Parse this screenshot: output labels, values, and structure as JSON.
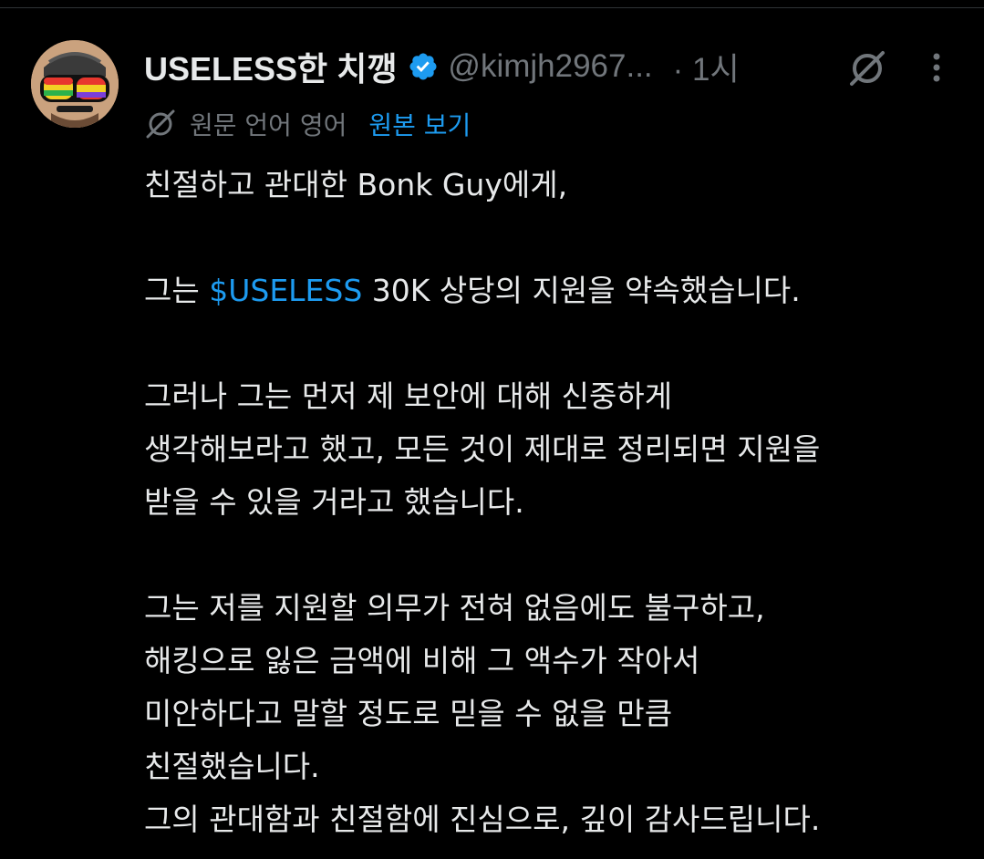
{
  "author": {
    "display_name": "USELESS한 치깽",
    "handle": "@kimjh2967...",
    "time": "· 1시",
    "verified": true,
    "verified_color": "#1d9bf0"
  },
  "icons": {
    "avatar": "avatar-cartoon-sunglasses",
    "verified": "verified-badge-icon",
    "grok": "grok-icon",
    "more": "more-vertical-icon",
    "translate": "grok-translate-icon"
  },
  "translation": {
    "label": "원문 언어 영어",
    "link": "원본 보기"
  },
  "tweet": {
    "line1": "친절하고 관대한 Bonk Guy에게,",
    "p2_before": "그는 ",
    "p2_cashtag": "$USELESS",
    "p2_after": " 30K 상당의 지원을 약속했습니다.",
    "p3_line1": "그러나 그는 먼저 제 보안에 대해 신중하게",
    "p3_line2": "생각해보라고 했고, 모든 것이 제대로 정리되면 지원을",
    "p3_line3": "받을 수 있을 거라고 했습니다.",
    "p4_line1": "그는 저를 지원할 의무가 전혀 없음에도 불구하고,",
    "p4_line2": "해킹으로 잃은 금액에 비해 그 액수가 작아서",
    "p4_line3": "미안하다고 말할 정도로 믿을 수 없을 만큼",
    "p4_line4": "친절했습니다.",
    "p4_line5": "그의 관대함과 친절함에 진심으로, 깊이 감사드립니다."
  },
  "colors": {
    "background": "#000000",
    "text": "#e7e9ea",
    "muted": "#71767b",
    "accent": "#1d9bf0"
  }
}
